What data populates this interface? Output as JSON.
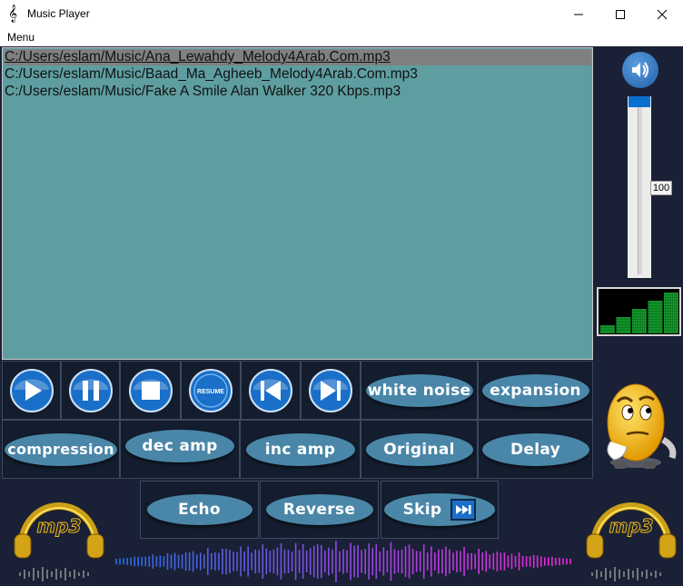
{
  "window": {
    "title": "Music Player",
    "app_icon": "music-note-icon"
  },
  "menu": {
    "label": "Menu"
  },
  "playlist": {
    "items": [
      "C:/Users/eslam/Music/Ana_Lewahdy_Melody4Arab.Com.mp3",
      "C:/Users/eslam/Music/Baad_Ma_Agheeb_Melody4Arab.Com.mp3",
      "C:/Users/eslam/Music/Fake A Smile Alan Walker 320 Kbps.mp3"
    ],
    "selected_index": 0
  },
  "controls": {
    "play_icon": "play-icon",
    "pause_icon": "pause-icon",
    "stop_icon": "stop-icon",
    "resume_label": "RESUME",
    "previous_icon": "previous-icon",
    "next_icon": "next-icon",
    "white_noise": "white noise",
    "expansion": "expansion",
    "compression": "compression",
    "dec_amp": "dec amp",
    "inc_amp": "inc amp",
    "original": "Original",
    "delay": "Delay",
    "echo": "Echo",
    "reverse": "Reverse",
    "skip": "Skip"
  },
  "volume": {
    "value": "100",
    "level": 1.0,
    "icon": "speaker-icon"
  },
  "logo": {
    "text": "mp3"
  },
  "colors": {
    "accent": "#4a86a8",
    "playlist_bg": "#5f9ea0",
    "panel_bg": "#131d2e",
    "button_blue": "#1a6fc8",
    "slider_thumb": "#0a70d0"
  }
}
